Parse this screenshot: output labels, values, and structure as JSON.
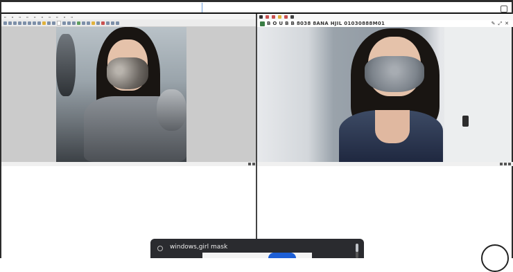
{
  "prompt": {
    "text": "windows,girl mask"
  },
  "right_viewer": {
    "title": "B O U B B  8038 8ANA HJIL 01030888M01"
  },
  "colors": {
    "prompt_bg": "#2a2b2f",
    "prompt_pill": "#1d5fd6"
  },
  "icons": {
    "link": "link-icon",
    "close": "close-icon"
  }
}
